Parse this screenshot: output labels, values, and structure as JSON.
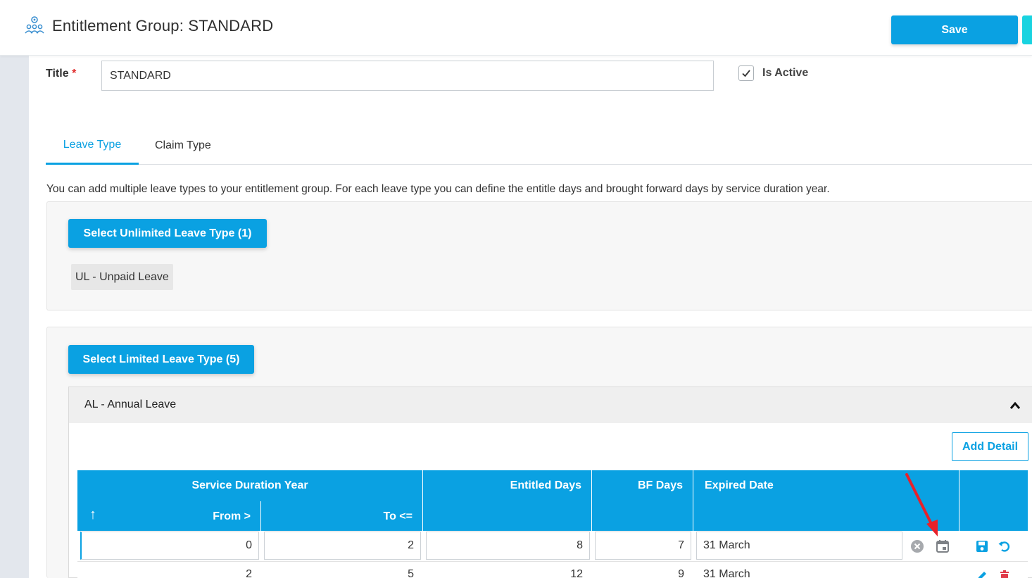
{
  "header": {
    "title": "Entitlement Group: STANDARD",
    "save_label": "Save",
    "icon": "group-settings-icon"
  },
  "form": {
    "title_label": "Title",
    "required_marker": "*",
    "title_value": "STANDARD",
    "is_active_label": "Is Active",
    "is_active_checked": true
  },
  "tabs": [
    {
      "label": "Leave Type",
      "active": true
    },
    {
      "label": "Claim Type",
      "active": false
    }
  ],
  "description": "You can add multiple leave types to your entitlement group. For each leave type you can define the entitle days and brought forward days by service duration year.",
  "unlimited": {
    "button_label": "Select Unlimited Leave Type (1)",
    "items": [
      "UL - Unpaid Leave"
    ]
  },
  "limited": {
    "button_label": "Select Limited Leave Type (5)",
    "accordion_title": "AL - Annual Leave",
    "add_detail_label": "Add Detail",
    "table": {
      "group_header": "Service Duration Year",
      "sort_indicator": "↑",
      "from_header": "From >",
      "to_header": "To <=",
      "entitled_header": "Entitled Days",
      "bf_header": "BF Days",
      "expired_header": "Expired Date",
      "rows": [
        {
          "from": "0",
          "to": "2",
          "entitled": "8",
          "bf": "7",
          "expired": "31 March",
          "editing": true
        },
        {
          "from": "2",
          "to": "5",
          "entitled": "12",
          "bf": "9",
          "expired": "31 March",
          "editing": false
        }
      ]
    }
  },
  "colors": {
    "accent": "#0aa1e2",
    "danger": "#e02b2b",
    "annotation_arrow": "#e8212a"
  }
}
